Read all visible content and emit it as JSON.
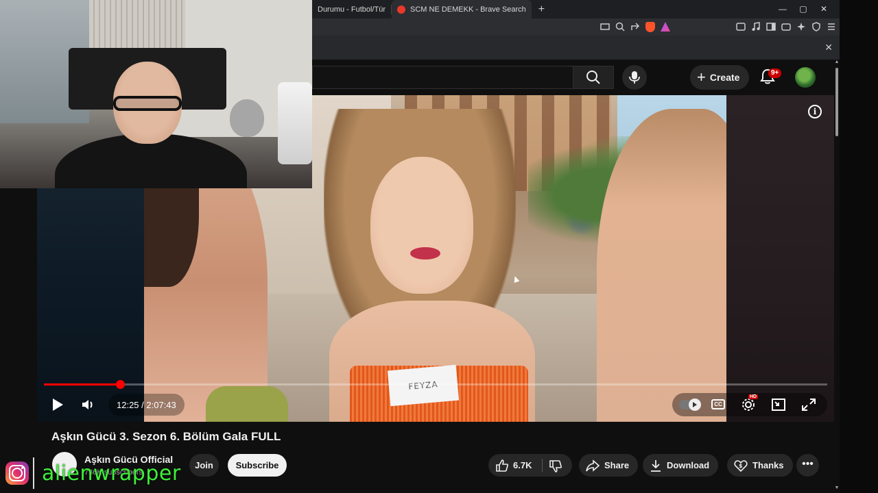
{
  "browser": {
    "tabs": [
      {
        "label": "Durumu - Futbol/Tür",
        "active": false
      },
      {
        "label": "SCM NE DEMEKK - Brave Search",
        "active": true
      }
    ],
    "new_tab_glyph": "+",
    "window_controls": [
      "—",
      "▢",
      "✕"
    ],
    "notice_close_glyph": "✕"
  },
  "youtube_header": {
    "create_label": "Create",
    "notification_badge": "9+"
  },
  "player": {
    "current_time": "12:25",
    "duration": "2:07:43",
    "time_display": "12:25 / 2:07:43",
    "progress_fraction": 0.097,
    "name_tag_text": "FEYZA",
    "info_glyph": "i",
    "cc_label": "CC",
    "hd_badge": "HD"
  },
  "video": {
    "title": "Aşkın Gücü 3. Sezon 6. Bölüm Gala FULL"
  },
  "channel": {
    "name": "Aşkın Gücü Official",
    "subscribers": "736K subscribers",
    "join_label": "Join",
    "subscribe_label": "Subscribe"
  },
  "actions": {
    "like_count": "6.7K",
    "share_label": "Share",
    "download_label": "Download",
    "thanks_label": "Thanks",
    "more_glyph": "•••"
  },
  "overlay": {
    "handle": "alienwrapper"
  },
  "colors": {
    "accent_red": "#ff0000",
    "handle_green": "#3ef03a",
    "badge_red": "#cc0000"
  }
}
